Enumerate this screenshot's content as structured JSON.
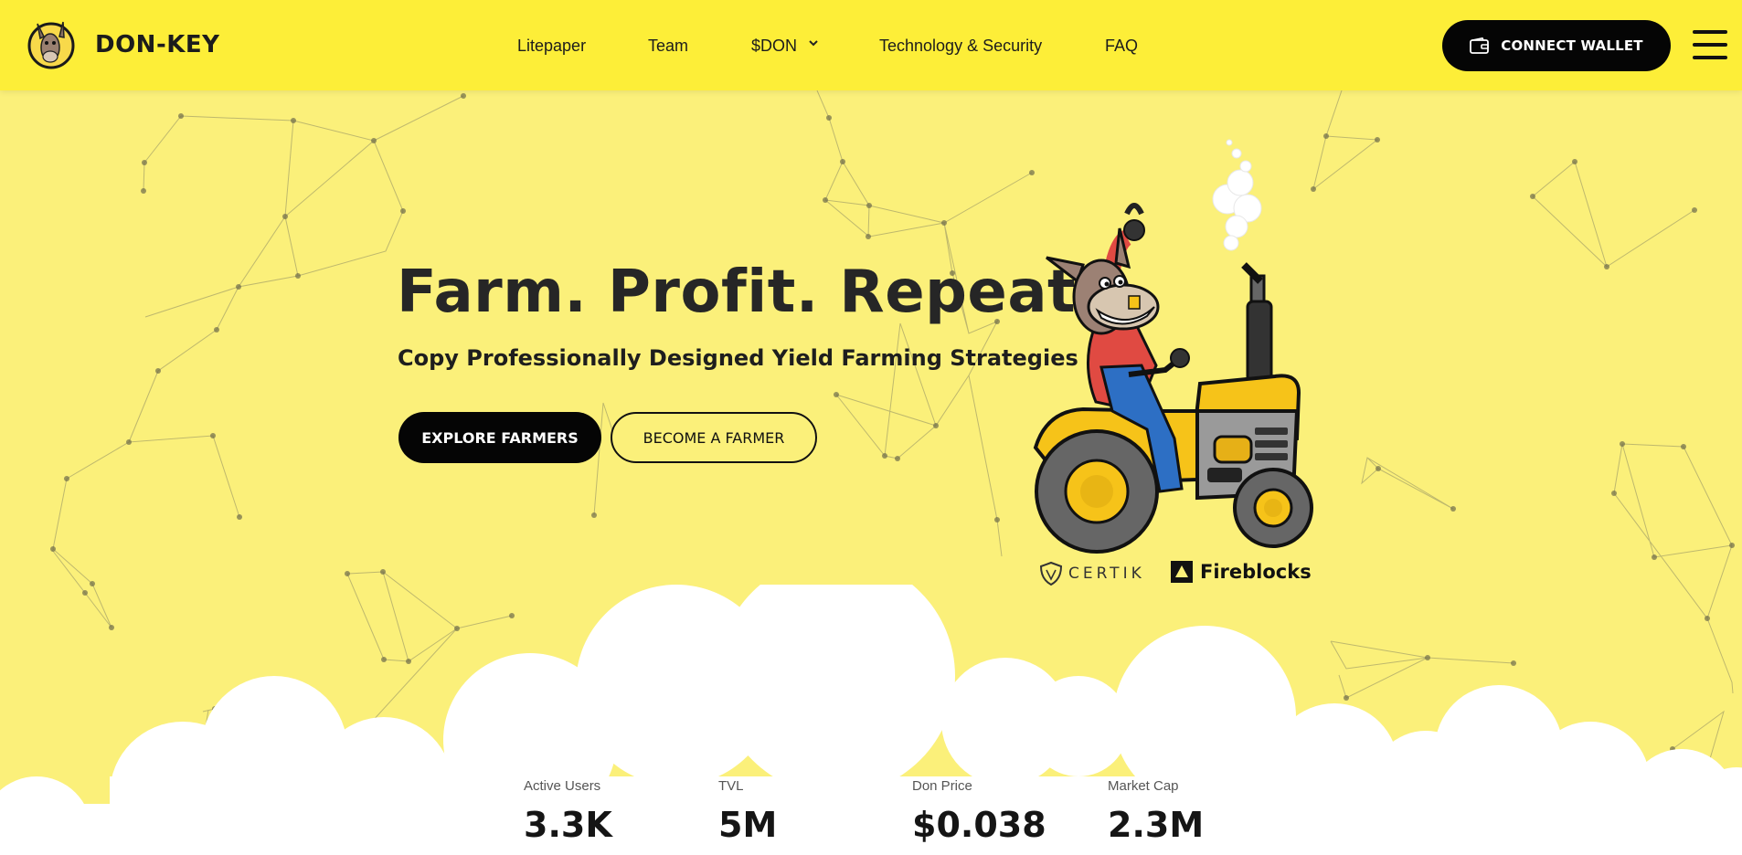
{
  "header": {
    "brand": "DON-KEY",
    "nav": [
      {
        "label": "Litepaper"
      },
      {
        "label": "Team"
      },
      {
        "label": "$DON",
        "has_dropdown": true
      },
      {
        "label": "Technology & Security"
      },
      {
        "label": "FAQ"
      }
    ],
    "connect_label": "CONNECT WALLET",
    "icons": {
      "connect": "wallet-icon",
      "menu": "hamburger-menu-icon",
      "dropdown": "chevron-down-icon"
    }
  },
  "hero": {
    "title": "Farm. Profit. Repeat.",
    "subtitle": "Copy Professionally Designed Yield Farming Strategies",
    "explore_label": "EXPLORE FARMERS",
    "become_label": "BECOME A FARMER"
  },
  "partners": [
    {
      "name": "CERTIK",
      "icon": "certik-shield-icon"
    },
    {
      "name": "Fireblocks",
      "icon": "fireblocks-triangle-icon"
    }
  ],
  "stats": [
    {
      "label": "Active Users",
      "value": "3.3K"
    },
    {
      "label": "TVL",
      "value": "5M"
    },
    {
      "label": "Don Price",
      "value": "$0.038"
    },
    {
      "label": "Market Cap",
      "value": "2.3M"
    }
  ],
  "colors": {
    "header_bg": "#fdee38",
    "page_bg": "#fbf07a",
    "button_dark": "#050505",
    "cloud": "#ffffff",
    "tractor_yellow": "#f6c319"
  }
}
